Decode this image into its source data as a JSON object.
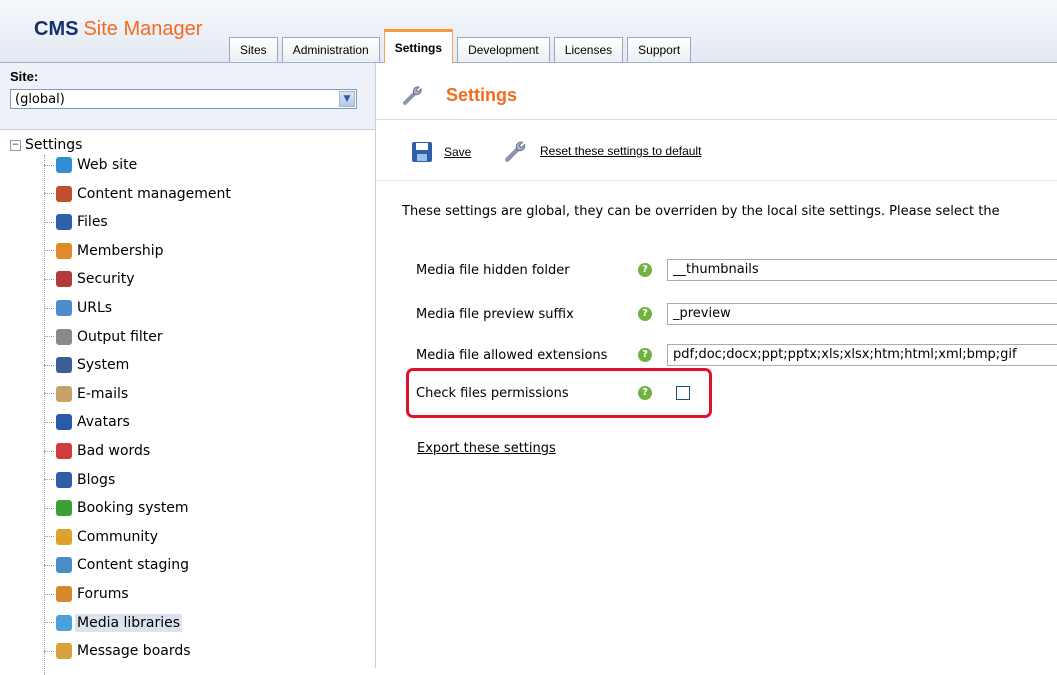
{
  "header": {
    "logo_cms": "CMS",
    "logo_site_manager": "Site Manager",
    "tabs": [
      {
        "label": "Sites"
      },
      {
        "label": "Administration"
      },
      {
        "label": "Settings"
      },
      {
        "label": "Development"
      },
      {
        "label": "Licenses"
      },
      {
        "label": "Support"
      }
    ],
    "active_tab": "Settings"
  },
  "sidebar": {
    "site_label": "Site:",
    "site_select_value": "(global)",
    "tree_root": "Settings",
    "tree_root_expander": "−",
    "items": [
      {
        "label": "Web site",
        "icon": "globe-icon",
        "color": "#2f8fd0"
      },
      {
        "label": "Content management",
        "icon": "content-management-icon",
        "color": "#c24f2c"
      },
      {
        "label": "Files",
        "icon": "floppy-disk-icon",
        "color": "#2d5fab"
      },
      {
        "label": "Membership",
        "icon": "user-icon",
        "color": "#e08a2c"
      },
      {
        "label": "Security",
        "icon": "security-icon",
        "color": "#b23a3a"
      },
      {
        "label": "URLs",
        "icon": "url-icon",
        "color": "#4d8bd1"
      },
      {
        "label": "Output filter",
        "icon": "funnel-icon",
        "color": "#8a8a8a"
      },
      {
        "label": "System",
        "icon": "monitor-icon",
        "color": "#3c5e92"
      },
      {
        "label": "E-mails",
        "icon": "envelope-icon",
        "color": "#c7a26a"
      },
      {
        "label": "Avatars",
        "icon": "avatar-icon",
        "color": "#2c5aa8"
      },
      {
        "label": "Bad words",
        "icon": "bad-words-icon",
        "color": "#d23b3b"
      },
      {
        "label": "Blogs",
        "icon": "blog-icon",
        "color": "#2e5ea8"
      },
      {
        "label": "Booking system",
        "icon": "booking-icon",
        "color": "#3aa03a"
      },
      {
        "label": "Community",
        "icon": "community-icon",
        "color": "#e0a12a"
      },
      {
        "label": "Content staging",
        "icon": "staging-icon",
        "color": "#4c8dc9"
      },
      {
        "label": "Forums",
        "icon": "forum-icon",
        "color": "#d88a2a"
      },
      {
        "label": "Media libraries",
        "icon": "media-library-icon",
        "color": "#4aa0d8"
      },
      {
        "label": "Message boards",
        "icon": "message-board-icon",
        "color": "#d9a13a"
      }
    ],
    "selected_item": "Media libraries"
  },
  "main": {
    "title": "Settings",
    "title_icon": "wrench-icon",
    "save_label": "Save",
    "save_icon": "floppy-disk-icon",
    "reset_label": "Reset these settings to default",
    "reset_icon": "wrench-icon",
    "description": "These settings are global, they can be overriden by the local site settings. Please select the",
    "fields": [
      {
        "label": "Media file hidden folder",
        "value": "__thumbnails"
      },
      {
        "label": "Media file preview suffix",
        "value": "_preview"
      },
      {
        "label": "Media file allowed extensions",
        "value": "pdf;doc;docx;ppt;pptx;xls;xlsx;htm;html;xml;bmp;gif"
      }
    ],
    "check_label": "Check files permissions",
    "check_value": false,
    "help_glyph": "?",
    "highlight_color": "#e0122a",
    "export_label": "Export these settings"
  },
  "colors": {
    "accent_orange": "#f26b1d",
    "brand_navy": "#15306b",
    "help_green": "#6fb23f"
  }
}
